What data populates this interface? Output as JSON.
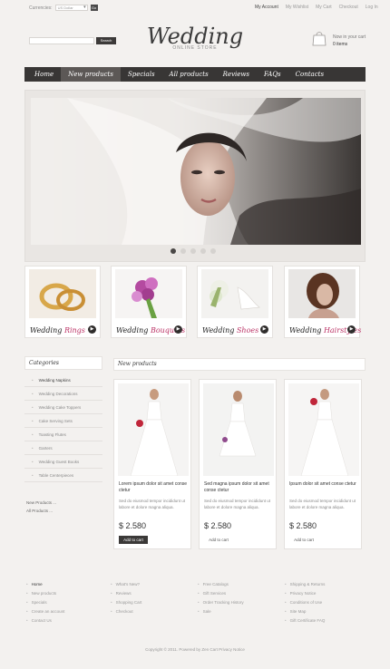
{
  "topbar": {
    "currency_label": "Currencies:",
    "currency_value": "US Dollar",
    "currency_go": "Go",
    "links": [
      "My Account",
      "My Wishlist",
      "My Cart",
      "Checkout",
      "Log In"
    ]
  },
  "header": {
    "search_button": "Search",
    "logo_title": "Wedding",
    "logo_subtitle": "ONLINE STORE",
    "cart_label": "Now in your cart",
    "cart_count": "0 items"
  },
  "nav": [
    "Home",
    "New products",
    "Specials",
    "All products",
    "Reviews",
    "FAQs",
    "Contacts"
  ],
  "slider": {
    "dots": 5,
    "active_dot": 0
  },
  "categories": [
    {
      "first": "Wedding",
      "second": "Rings"
    },
    {
      "first": "Wedding",
      "second": "Bouquets"
    },
    {
      "first": "Wedding",
      "second": "Shoes"
    },
    {
      "first": "Wedding",
      "second": "Hairstyles"
    }
  ],
  "sidebar": {
    "title": "Categories",
    "items": [
      "Wedding Napkins",
      "Wedding Decorations",
      "Wedding Cake Toppers",
      "Cake Serving Sets",
      "Toasting Flutes",
      "Garters",
      "Wedding Guest Books",
      "Table Centerpieces"
    ],
    "links": [
      "New Products ...",
      "All Products ..."
    ]
  },
  "products": {
    "title": "New products",
    "items": [
      {
        "name": "Lorem ipsum dolor sit amet conse ctetur",
        "desc": "Sed do eiusmod tempor incididunt ut labore et dolore magna aliqua.",
        "price": "$ 2.580",
        "button": "Add to cart"
      },
      {
        "name": "Sed magna ipsum dolor sit amet conse ctetur",
        "desc": "Sed do eiusmod tempor incididunt ut labore et dolore magna aliqua.",
        "price": "$ 2.580",
        "button": "Add to cart"
      },
      {
        "name": "Ipsum dolor sit amet conse ctetur",
        "desc": "Sed do eiusmod tempor incididunt ut labore et dolore magna aliqua.",
        "price": "$ 2.580",
        "button": "Add to cart"
      }
    ]
  },
  "footer": {
    "col1": [
      "Home",
      "New products",
      "Specials",
      "Create an account",
      "Contact Us"
    ],
    "col2": [
      "What's New?",
      "Reviews",
      "Shopping Cart",
      "Checkout"
    ],
    "col3": [
      "Free Catalogs",
      "Gift Services",
      "Order Tracking History",
      "Sale"
    ],
    "col4": [
      "Shipping & Returns",
      "Privacy Notice",
      "Conditions of Use",
      "Site Map",
      "Gift Certificate FAQ"
    ],
    "copyright": "Copyright © 2011. Powered by Zen Cart Privacy Notice"
  },
  "colors": {
    "nav_bg": "#383635",
    "accent": "#b33366",
    "page_bg": "#f3f1ef"
  }
}
